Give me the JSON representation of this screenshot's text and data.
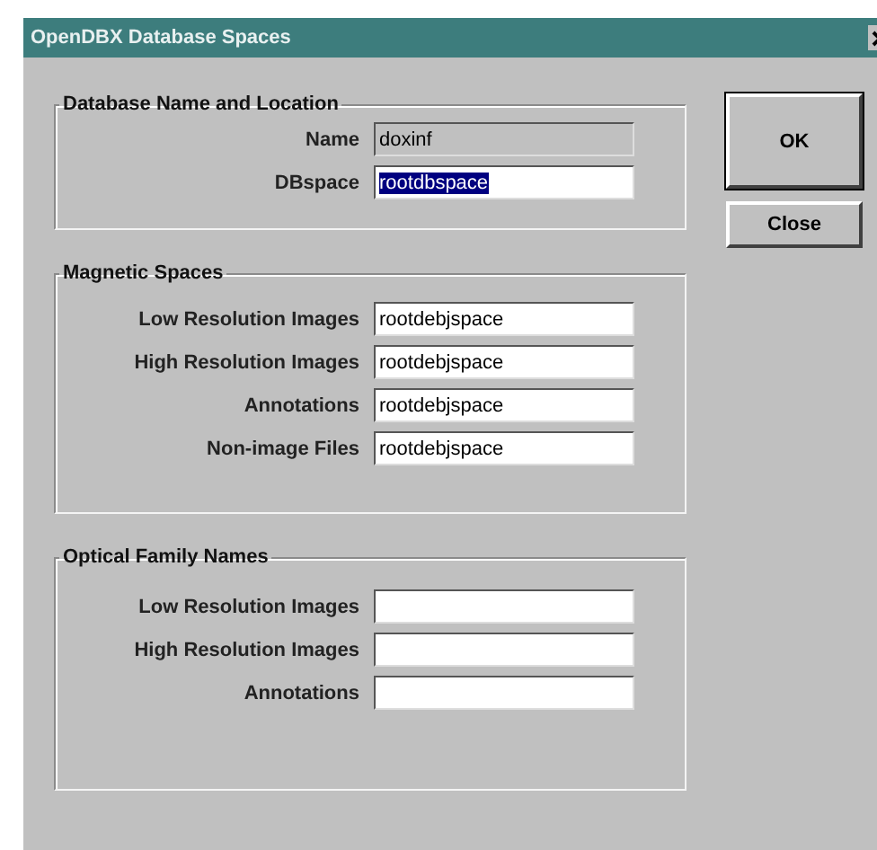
{
  "window": {
    "title": "OpenDBX Database Spaces"
  },
  "groups": [
    {
      "title": "Database Name and Location",
      "fields": [
        {
          "label": "Name",
          "value": "doxinf",
          "disabled": true,
          "selected": false
        },
        {
          "label": "DBspace",
          "value": "rootdbspace",
          "disabled": false,
          "selected": true
        }
      ]
    },
    {
      "title": "Magnetic Spaces",
      "fields": [
        {
          "label": "Low Resolution Images",
          "value": "rootdebjspace",
          "disabled": false,
          "selected": false
        },
        {
          "label": "High Resolution Images",
          "value": "rootdebjspace",
          "disabled": false,
          "selected": false
        },
        {
          "label": "Annotations",
          "value": "rootdebjspace",
          "disabled": false,
          "selected": false
        },
        {
          "label": "Non-image Files",
          "value": "rootdebjspace",
          "disabled": false,
          "selected": false
        }
      ]
    },
    {
      "title": "Optical Family Names",
      "fields": [
        {
          "label": "Low Resolution Images",
          "disabled": false
        },
        {
          "label": "High Resolution Images",
          "disabled": false
        },
        {
          "label": "Annotations",
          "disabled": false
        }
      ]
    }
  ],
  "buttons": [
    {
      "label": "OK",
      "default": true
    },
    {
      "label": "Close",
      "default": false
    }
  ]
}
